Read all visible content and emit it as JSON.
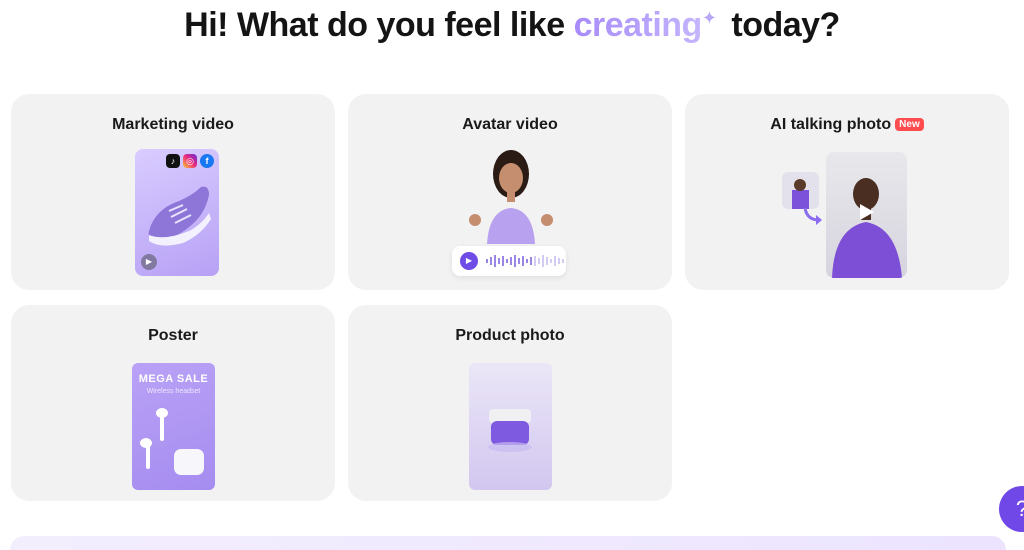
{
  "header": {
    "title_prefix": "Hi! What do you feel like",
    "title_highlight": "creating",
    "title_suffix": "today?"
  },
  "cards": [
    {
      "label": "Marketing video"
    },
    {
      "label": "Avatar video"
    },
    {
      "label": "AI talking photo",
      "badge": "New"
    },
    {
      "label": "Poster",
      "poster_title": "MEGA SALE",
      "poster_subtitle": "Wireless headset"
    },
    {
      "label": "Product photo"
    }
  ],
  "icons": {
    "social": [
      "tiktok-icon",
      "instagram-icon",
      "facebook-icon"
    ],
    "help": "help-icon"
  },
  "colors": {
    "accent": "#7048e8",
    "card_bg": "#f2f2f3",
    "badge": "#ff4d4f"
  }
}
